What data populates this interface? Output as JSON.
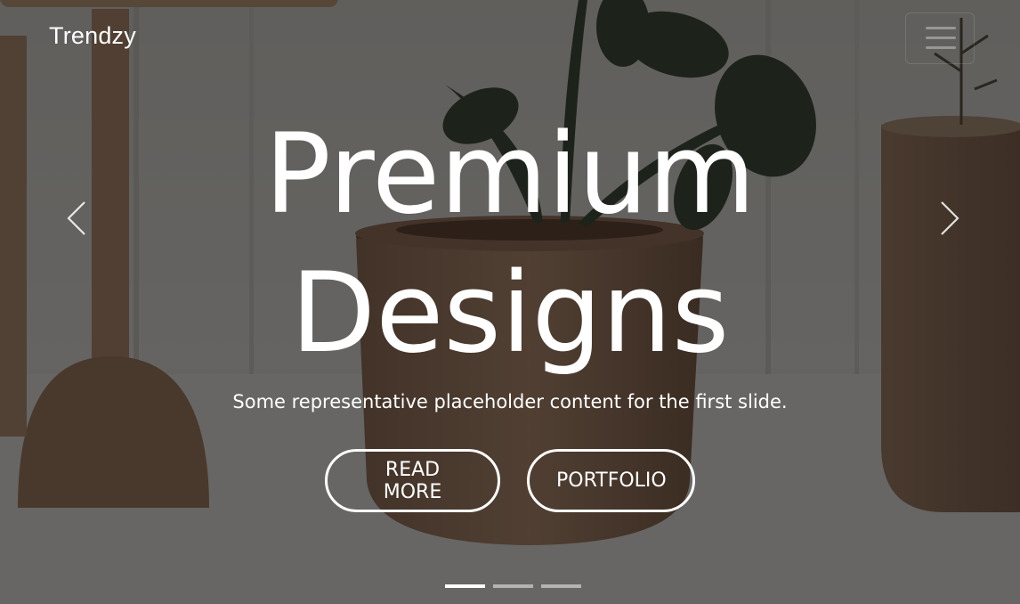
{
  "navbar": {
    "brand": "Trendzy",
    "toggler_icon": "hamburger-menu-icon"
  },
  "carousel": {
    "prev_icon": "chevron-left-icon",
    "next_icon": "chevron-right-icon",
    "active_slide": 1,
    "slide_count": 3,
    "slides": [
      {
        "headline_line1": "Premium",
        "headline_line2": "Designs",
        "text": "Some representative placeholder content for the first slide.",
        "buttons": [
          {
            "label": "READ MORE"
          },
          {
            "label": "PORTFOLIO"
          }
        ]
      }
    ]
  },
  "colors": {
    "text": "#ffffff",
    "overlay": "rgba(0,0,0,0.52)",
    "indicator_inactive": "rgba(255,255,255,0.5)"
  }
}
